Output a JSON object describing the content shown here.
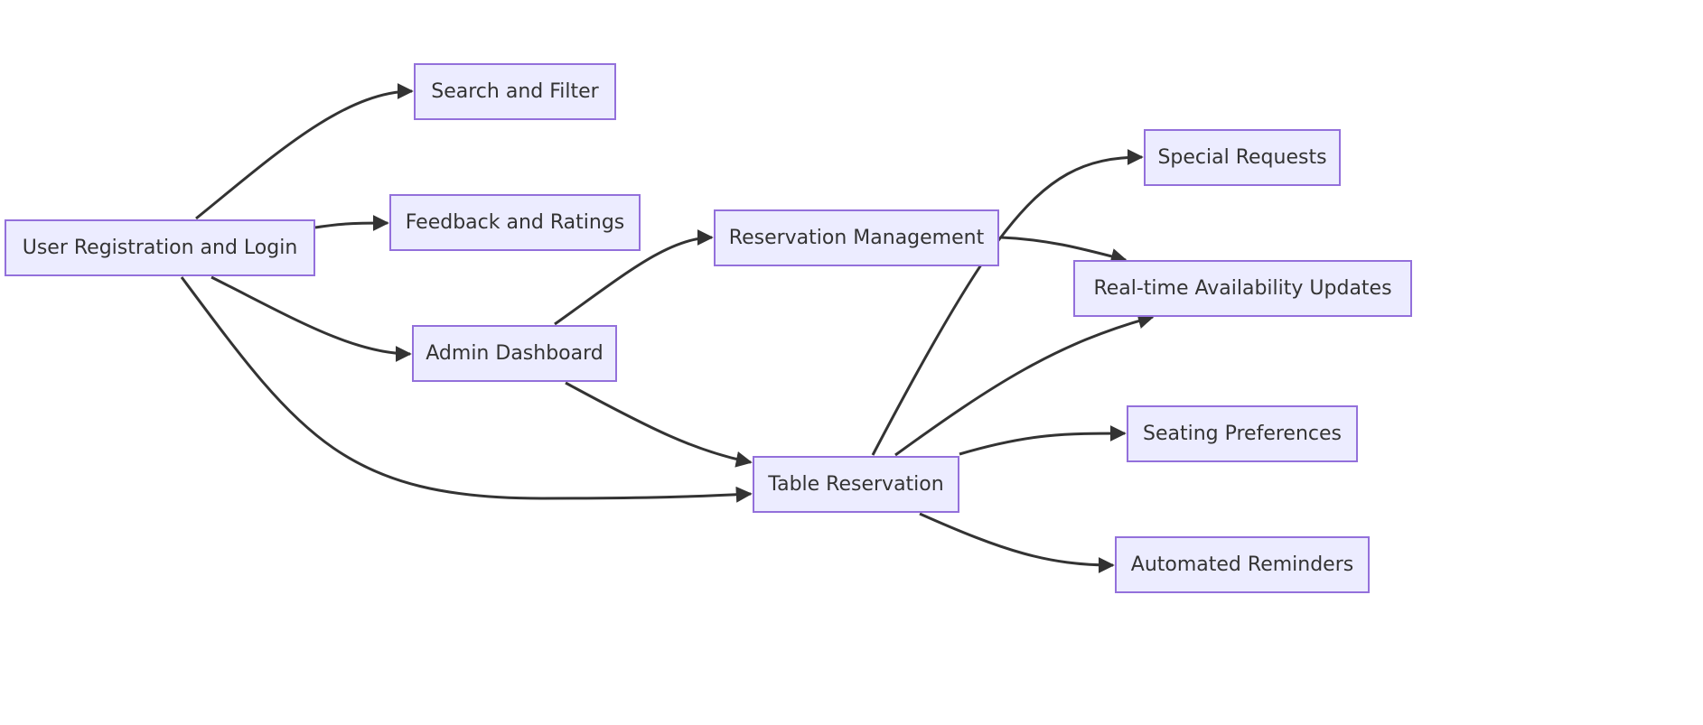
{
  "colors": {
    "node_fill": "#ECECFF",
    "node_stroke": "#9370DB",
    "edge": "#333333"
  },
  "nodes": {
    "user_registration": "User Registration and Login",
    "search_filter": "Search and Filter",
    "feedback": "Feedback and Ratings",
    "admin_dashboard": "Admin Dashboard",
    "reservation_management": "Reservation Management",
    "table_reservation": "Table Reservation",
    "special_requests": "Special Requests",
    "realtime_updates": "Real-time Availability Updates",
    "seating_preferences": "Seating Preferences",
    "automated_reminders": "Automated Reminders"
  },
  "edges": [
    {
      "from": "user_registration",
      "to": "search_filter"
    },
    {
      "from": "user_registration",
      "to": "feedback"
    },
    {
      "from": "user_registration",
      "to": "admin_dashboard"
    },
    {
      "from": "user_registration",
      "to": "table_reservation"
    },
    {
      "from": "admin_dashboard",
      "to": "reservation_management"
    },
    {
      "from": "admin_dashboard",
      "to": "table_reservation"
    },
    {
      "from": "table_reservation",
      "to": "special_requests"
    },
    {
      "from": "reservation_management",
      "to": "realtime_updates"
    },
    {
      "from": "table_reservation",
      "to": "realtime_updates"
    },
    {
      "from": "table_reservation",
      "to": "seating_preferences"
    },
    {
      "from": "table_reservation",
      "to": "automated_reminders"
    }
  ]
}
